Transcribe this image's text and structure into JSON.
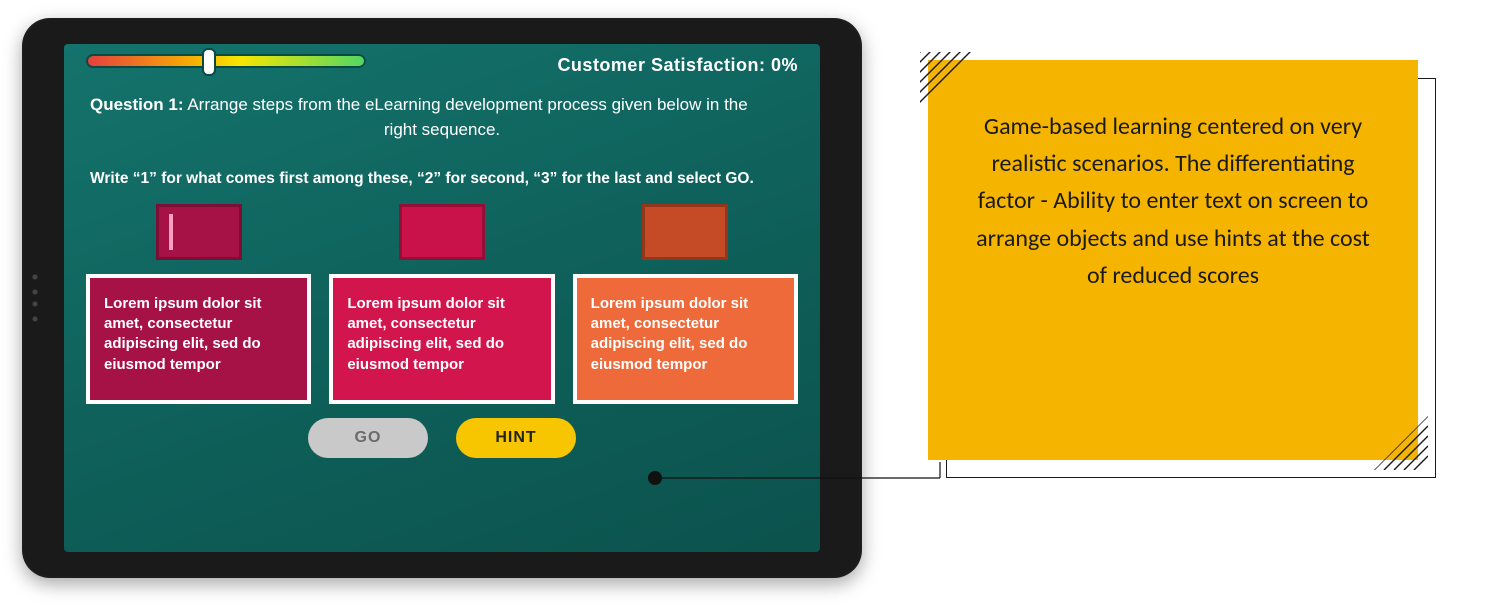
{
  "header": {
    "satisfaction_label": "Customer Satisfaction: 0%"
  },
  "question": {
    "label": "Question 1:",
    "text_a": "Arrange steps from the eLearning development process given below in the",
    "text_b": "right sequence.",
    "instruction": "Write “1” for what comes first among these, “2” for second, “3” for the last and select GO."
  },
  "cards": [
    {
      "text": "Lorem ipsum dolor sit amet, consectetur adipiscing elit, sed do eiusmod tempor"
    },
    {
      "text": "Lorem ipsum dolor sit amet, consectetur adipiscing elit, sed do eiusmod tempor"
    },
    {
      "text": "Lorem ipsum dolor sit amet, consectetur adipiscing elit, sed do eiusmod tempor"
    }
  ],
  "buttons": {
    "go": "GO",
    "hint": "HINT"
  },
  "callout": {
    "text": "Game-based learning centered on very realistic scenarios. The differentiating factor - Ability to enter text on screen to arrange objects and use hints at the cost of reduced scores"
  }
}
